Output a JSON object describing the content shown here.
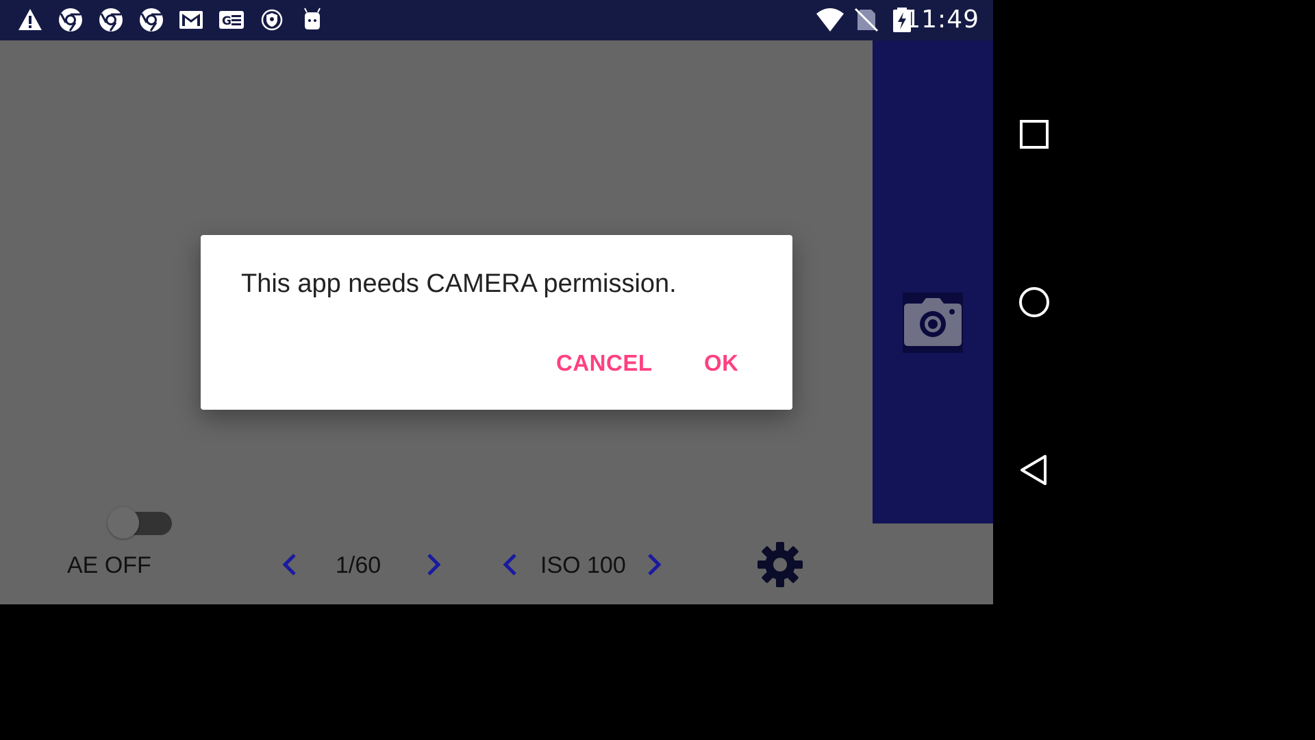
{
  "status_bar": {
    "time": "11:49",
    "left_icons": [
      "warning-icon",
      "chrome-icon",
      "chrome-icon",
      "chrome-icon",
      "gmail-icon",
      "news-icon",
      "vpn-shield-icon",
      "android-debug-icon"
    ],
    "right_icons": [
      "wifi-icon",
      "no-sim-icon",
      "battery-charging-icon"
    ]
  },
  "bottom_bar": {
    "ae_label": "AE OFF",
    "ae_toggle_on": false,
    "shutter_value": "1/60",
    "iso_value": "ISO 100",
    "settings_icon": "gear-icon"
  },
  "side_panel": {
    "capture_icon": "camera-icon"
  },
  "dialog": {
    "message": "This app needs CAMERA permission.",
    "cancel_label": "CANCEL",
    "ok_label": "OK"
  },
  "colors": {
    "status_bar": "#151a45",
    "dim_overlay": "#666666",
    "side_panel": "#131357",
    "dialog_accent": "#ff4081",
    "chevron": "#1a1aa0"
  }
}
